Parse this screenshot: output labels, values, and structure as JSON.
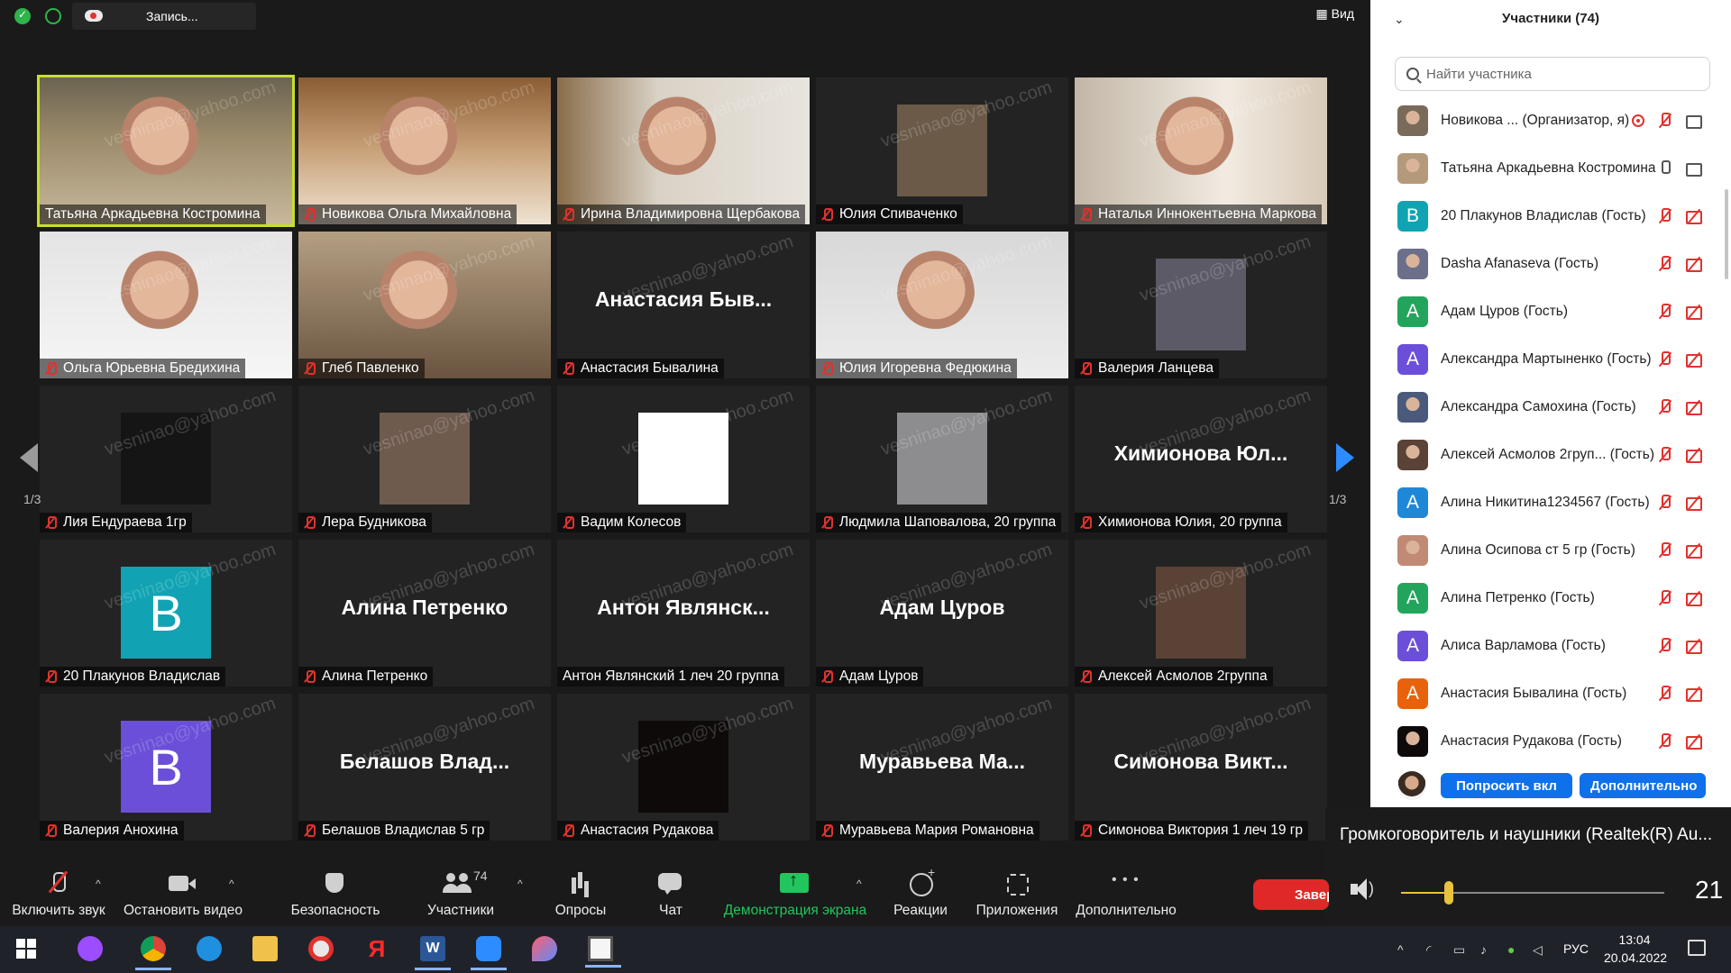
{
  "topbar": {
    "recording_label": "Запись...",
    "view_label": "Вид"
  },
  "grid": {
    "page_indicator_left": "1/3",
    "page_indicator_right": "1/3",
    "watermark": "vesninao@yahoo.com",
    "tiles": [
      {
        "name": "Татьяна Аркадьевна Костромина",
        "muted": false,
        "active": true,
        "kind": "video",
        "bg": "office"
      },
      {
        "name": "Новикова Ольга Михайловна",
        "muted": true,
        "kind": "video",
        "bg": "warm"
      },
      {
        "name": "Ирина Владимировна Щербакова",
        "muted": true,
        "kind": "video",
        "bg": "room"
      },
      {
        "name": "Юлия Спиваченко",
        "muted": true,
        "kind": "picture",
        "pic_color": "#6b5a48"
      },
      {
        "name": "Наталья Иннокентьевна Маркова",
        "muted": true,
        "kind": "video",
        "bg": "pair"
      },
      {
        "name": "Ольга Юрьевна Бредихина",
        "muted": true,
        "kind": "video",
        "bg": "white"
      },
      {
        "name": "Глеб Павленко",
        "muted": true,
        "kind": "video",
        "bg": "teen"
      },
      {
        "name": "Анастасия Бывалина",
        "muted": true,
        "kind": "text",
        "center": "Анастасия Быв..."
      },
      {
        "name": "Юлия Игоревна Федюкина",
        "muted": true,
        "kind": "video",
        "bg": "light"
      },
      {
        "name": "Валерия Ланцева",
        "muted": true,
        "kind": "picture",
        "pic_color": "#5b5a66"
      },
      {
        "name": "Лия Ендураева 1гр",
        "muted": true,
        "kind": "picture",
        "pic_color": "#151515"
      },
      {
        "name": "Лера Будникова",
        "muted": true,
        "kind": "picture",
        "pic_color": "#6f5a4e"
      },
      {
        "name": "Вадим Колесов",
        "muted": true,
        "kind": "picture",
        "pic_color": "#ffffff"
      },
      {
        "name": "Людмила Шаповалова, 20 группа",
        "muted": true,
        "kind": "picture",
        "pic_color": "#8d8c8e"
      },
      {
        "name": "Химионова Юлия, 20 группа",
        "muted": true,
        "kind": "text",
        "center": "Химионова Юл..."
      },
      {
        "name": "20 Плакунов Владислав",
        "muted": true,
        "kind": "letter",
        "letter": "B",
        "color": "#11a3b3"
      },
      {
        "name": "Алина Петренко",
        "muted": true,
        "kind": "text",
        "center": "Алина Петренко"
      },
      {
        "name": "Антон Являнский 1 леч 20 группа",
        "muted": false,
        "kind": "text",
        "center": "Антон Являнск..."
      },
      {
        "name": "Адам Цуров",
        "muted": true,
        "kind": "text",
        "center": "Адам Цуров"
      },
      {
        "name": "Алексей Асмолов 2группа",
        "muted": true,
        "kind": "picture",
        "pic_color": "#5a4236"
      },
      {
        "name": "Валерия Анохина",
        "muted": true,
        "kind": "letter",
        "letter": "B",
        "color": "#6b4fd8"
      },
      {
        "name": "Белашов Владислав 5 гр",
        "muted": true,
        "kind": "text",
        "center": "Белашов Влад..."
      },
      {
        "name": "Анастасия Рудакова",
        "muted": true,
        "kind": "picture",
        "pic_color": "#0d0a09"
      },
      {
        "name": "Муравьева Мария Романовна",
        "muted": true,
        "kind": "text",
        "center": "Муравьева Ма..."
      },
      {
        "name": "Симонова Виктория 1 леч 19 гр",
        "muted": true,
        "kind": "text",
        "center": "Симонова Викт..."
      }
    ]
  },
  "panel": {
    "title": "Участники (74)",
    "search_placeholder": "Найти участника",
    "participants": [
      {
        "name": "Новикова ... (Организатор, я)",
        "avatar": "photo",
        "color": "#7a6a5a",
        "rec": true,
        "mic": "off",
        "cam": "on"
      },
      {
        "name": "Татьяна Аркадьевна Костромина",
        "avatar": "photo",
        "color": "#b49a7a",
        "mic": "on",
        "cam": "on"
      },
      {
        "name": "20 Плакунов Владислав (Гость)",
        "avatar": "letter",
        "letter": "B",
        "color": "#11a3b3",
        "mic": "off",
        "cam": "off"
      },
      {
        "name": "Dasha Afanaseva (Гость)",
        "avatar": "photo",
        "color": "#6b6f8a",
        "mic": "off",
        "cam": "off"
      },
      {
        "name": "Адам Цуров (Гость)",
        "avatar": "letter",
        "letter": "A",
        "color": "#22a45d",
        "mic": "off",
        "cam": "off"
      },
      {
        "name": "Александра Мартыненко (Гость)",
        "avatar": "letter",
        "letter": "A",
        "color": "#6b4fd8",
        "mic": "off",
        "cam": "off"
      },
      {
        "name": "Александра Самохина (Гость)",
        "avatar": "photo",
        "color": "#4b5a7a",
        "mic": "off",
        "cam": "off"
      },
      {
        "name": "Алексей Асмолов 2груп... (Гость)",
        "avatar": "photo",
        "color": "#5a4236",
        "mic": "off",
        "cam": "off"
      },
      {
        "name": "Алина Никитина1234567 (Гость)",
        "avatar": "letter",
        "letter": "A",
        "color": "#1f87d8",
        "mic": "off",
        "cam": "off"
      },
      {
        "name": "Алина Осипова ст 5 гр (Гость)",
        "avatar": "photo",
        "color": "#c08a74",
        "mic": "off",
        "cam": "off"
      },
      {
        "name": "Алина Петренко (Гость)",
        "avatar": "letter",
        "letter": "A",
        "color": "#22a45d",
        "mic": "off",
        "cam": "off"
      },
      {
        "name": "Алиса Варламова (Гость)",
        "avatar": "letter",
        "letter": "A",
        "color": "#6b4fd8",
        "mic": "off",
        "cam": "off"
      },
      {
        "name": "Анастасия Бывалина (Гость)",
        "avatar": "letter",
        "letter": "A",
        "color": "#e8620c",
        "mic": "off",
        "cam": "off"
      },
      {
        "name": "Анастасия Рудакова (Гость)",
        "avatar": "photo",
        "color": "#0d0a09",
        "mic": "off",
        "cam": "off"
      }
    ],
    "ask_button": "Попросить вкл",
    "more_button": "Дополнительно"
  },
  "audio": {
    "device": "Громкоговоритель и наушники (Realtek(R) Au...",
    "volume": 21,
    "volume_fraction": 0.18
  },
  "toolbar": {
    "unmute": "Включить звук",
    "stop_video": "Остановить видео",
    "security": "Безопасность",
    "participants": "Участники",
    "participants_count": "74",
    "polls": "Опросы",
    "chat": "Чат",
    "share": "Демонстрация экрана",
    "reactions": "Реакции",
    "apps": "Приложения",
    "more": "Дополнительно",
    "end": "Завершить"
  },
  "taskbar": {
    "time": "13:04",
    "date": "20.04.2022",
    "lang": "РУС"
  },
  "colors": {
    "accent_blue": "#0e71eb",
    "share_green": "#22c55e",
    "end_red": "#e02828",
    "muted_red": "#e0322e",
    "active_speaker": "#c7df2b"
  }
}
